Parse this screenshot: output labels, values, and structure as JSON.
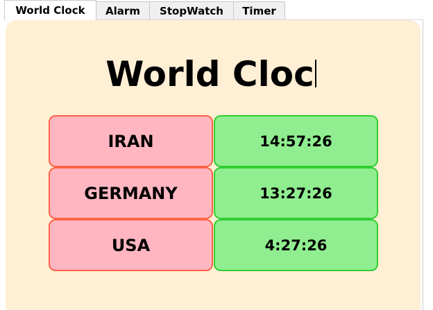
{
  "tabs": [
    {
      "label": "World Clock",
      "active": true
    },
    {
      "label": "Alarm",
      "active": false
    },
    {
      "label": "StopWatch",
      "active": false
    },
    {
      "label": "Timer",
      "active": false
    }
  ],
  "page_title": "World Cloc",
  "clocks": [
    {
      "country": "IRAN",
      "time": "14:57:26"
    },
    {
      "country": "GERMANY",
      "time": "13:27:26"
    },
    {
      "country": "USA",
      "time": "4:27:26"
    }
  ],
  "colors": {
    "panel_bg": "#ffefd5",
    "country_bg": "#ffb6c1",
    "country_border": "#ff6347",
    "time_bg": "#90ee90",
    "time_border": "#32cd32"
  }
}
